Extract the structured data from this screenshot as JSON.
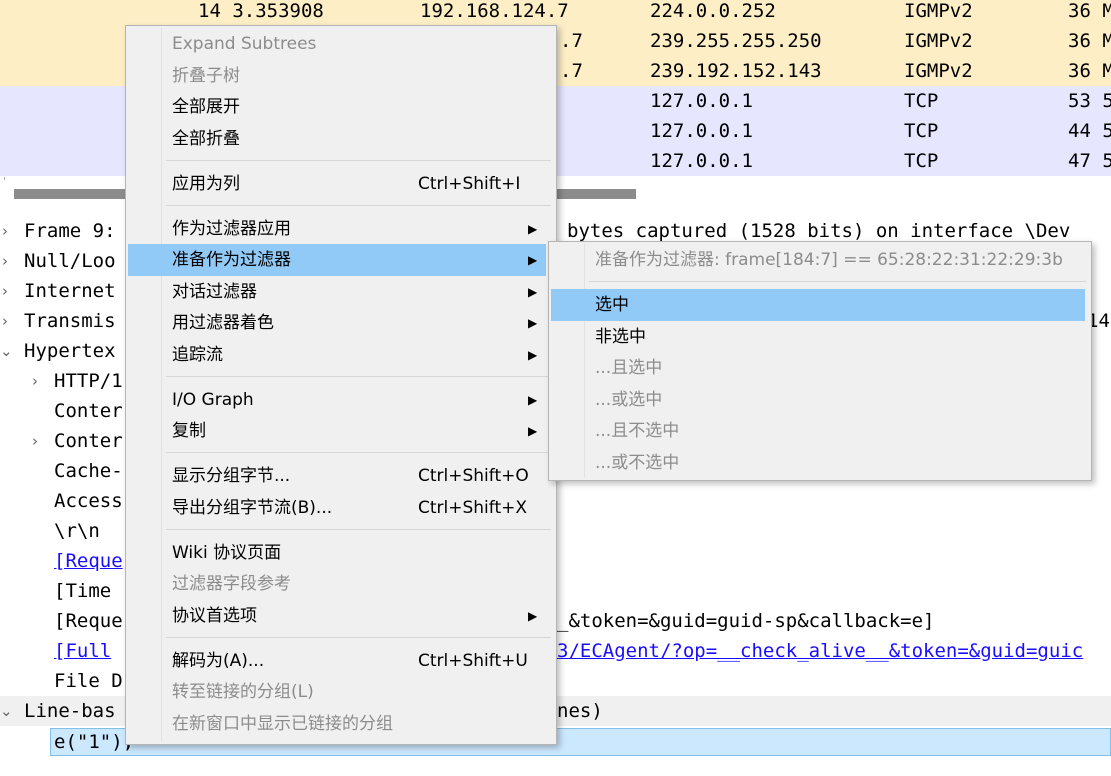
{
  "packets": [
    {
      "no": "14 3.353908",
      "src": "192.168.124.7",
      "dst": "224.0.0.252",
      "proto": "IGMPv2",
      "len": "36 M",
      "bg": "#fdeec6"
    },
    {
      "no": "",
      "src": ".7",
      "dst": "239.255.255.250",
      "proto": "IGMPv2",
      "len": "36 M",
      "bg": "#fdeec6"
    },
    {
      "no": "",
      "src": ".7",
      "dst": "239.192.152.143",
      "proto": "IGMPv2",
      "len": "36 M",
      "bg": "#fdeec6"
    },
    {
      "no": "",
      "src": "",
      "dst": "127.0.0.1",
      "proto": "TCP",
      "len": "53 5",
      "bg": "#e6e6ff"
    },
    {
      "no": "",
      "src": "",
      "dst": "127.0.0.1",
      "proto": "TCP",
      "len": "44 5",
      "bg": "#e6e6ff"
    },
    {
      "no": "",
      "src": "",
      "dst": "127.0.0.1",
      "proto": "TCP",
      "len": "47 5",
      "bg": "#e6e6ff"
    }
  ],
  "detail": {
    "rows": [
      {
        "text": "Frame 9:",
        "tail": "bytes captured (1528 bits) on interface \\Dev"
      },
      {
        "text": "Null/Loo",
        "tail": ""
      },
      {
        "text": "Internet",
        "tail": ""
      },
      {
        "text": "Transmis",
        "tail": "14"
      },
      {
        "text": "Hypertex",
        "tail": ""
      },
      {
        "text": "HTTP/1",
        "tail": ""
      },
      {
        "text": "Conter",
        "tail": ""
      },
      {
        "text": "Conter",
        "tail": ""
      },
      {
        "text": "Cache-",
        "tail": ""
      },
      {
        "text": "Access",
        "tail": ""
      },
      {
        "text": "\\r\\n",
        "tail": ""
      },
      {
        "text": "[Reque",
        "tail": ""
      },
      {
        "text": "[Time",
        "tail": ""
      },
      {
        "text": "[Reque",
        "tail": "_&token=&guid=guid-sp&callback=e]"
      },
      {
        "text": "[Full",
        "tail": "3/ECAgent/?op=__check_alive__&token=&guid=guic"
      },
      {
        "text": "File D",
        "tail": ""
      },
      {
        "text": "Line-bas",
        "tail": "nes)"
      },
      {
        "text": "e(\"1\");",
        "tail": ""
      }
    ]
  },
  "menu": {
    "items": [
      {
        "label": "Expand Subtrees",
        "shortcut": "",
        "disabled": true,
        "submenu": false
      },
      {
        "label": "折叠子树",
        "shortcut": "",
        "disabled": true,
        "submenu": false
      },
      {
        "label": "全部展开",
        "shortcut": "",
        "disabled": false,
        "submenu": false
      },
      {
        "label": "全部折叠",
        "shortcut": "",
        "disabled": false,
        "submenu": false
      },
      {
        "label": "应用为列",
        "shortcut": "Ctrl+Shift+I",
        "disabled": false,
        "submenu": false
      },
      {
        "label": "作为过滤器应用",
        "shortcut": "",
        "disabled": false,
        "submenu": true
      },
      {
        "label": "准备作为过滤器",
        "shortcut": "",
        "disabled": false,
        "submenu": true
      },
      {
        "label": "对话过滤器",
        "shortcut": "",
        "disabled": false,
        "submenu": true
      },
      {
        "label": "用过滤器着色",
        "shortcut": "",
        "disabled": false,
        "submenu": true
      },
      {
        "label": "追踪流",
        "shortcut": "",
        "disabled": false,
        "submenu": true
      },
      {
        "label": "I/O Graph",
        "shortcut": "",
        "disabled": false,
        "submenu": true
      },
      {
        "label": "复制",
        "shortcut": "",
        "disabled": false,
        "submenu": true
      },
      {
        "label": "显示分组字节...",
        "shortcut": "Ctrl+Shift+O",
        "disabled": false,
        "submenu": false
      },
      {
        "label": "导出分组字节流(B)...",
        "shortcut": "Ctrl+Shift+X",
        "disabled": false,
        "submenu": false
      },
      {
        "label": "Wiki 协议页面",
        "shortcut": "",
        "disabled": false,
        "submenu": false
      },
      {
        "label": "过滤器字段参考",
        "shortcut": "",
        "disabled": true,
        "submenu": false
      },
      {
        "label": "协议首选项",
        "shortcut": "",
        "disabled": false,
        "submenu": true
      },
      {
        "label": "解码为(A)...",
        "shortcut": "Ctrl+Shift+U",
        "disabled": false,
        "submenu": false
      },
      {
        "label": "转至链接的分组(L)",
        "shortcut": "",
        "disabled": true,
        "submenu": false
      },
      {
        "label": "在新窗口中显示已链接的分组",
        "shortcut": "",
        "disabled": true,
        "submenu": false
      }
    ]
  },
  "submenu": {
    "header": "准备作为过滤器: frame[184:7] == 65:28:22:31:22:29:3b",
    "items": [
      {
        "label": "选中",
        "disabled": false
      },
      {
        "label": "非选中",
        "disabled": false
      },
      {
        "label": "...且选中",
        "disabled": true
      },
      {
        "label": "...或选中",
        "disabled": true
      },
      {
        "label": "...且不选中",
        "disabled": true
      },
      {
        "label": "...或不选中",
        "disabled": true
      }
    ]
  },
  "colors": {
    "igmp_row": "#fdeec6",
    "tcp_row": "#e6e6ff",
    "menu_highlight": "#91c9f7",
    "link": "#1a0dff"
  }
}
